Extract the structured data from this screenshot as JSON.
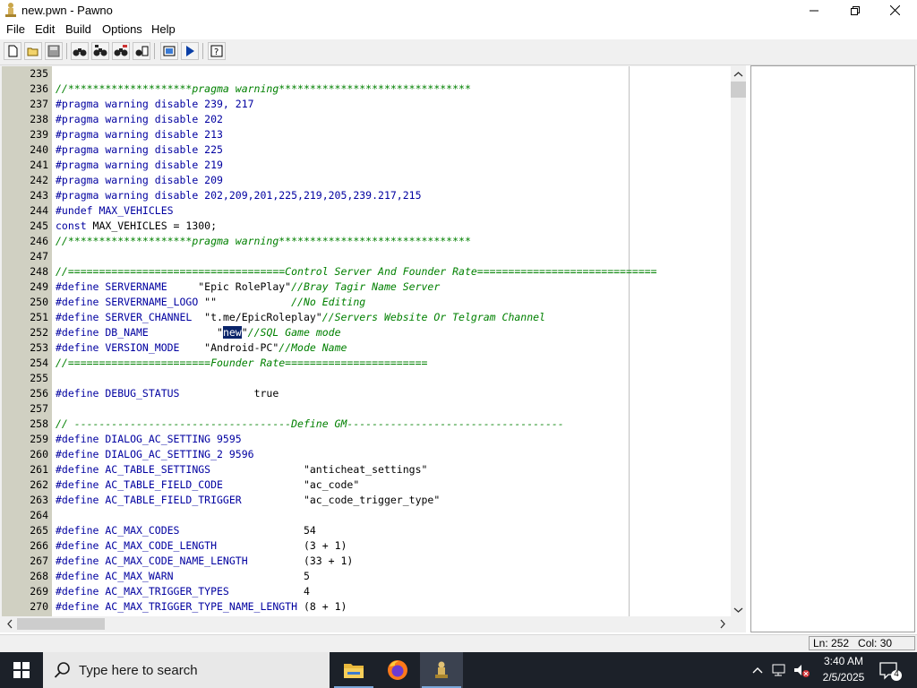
{
  "window": {
    "title": "new.pwn - Pawno"
  },
  "menu": [
    "File",
    "Edit",
    "Build",
    "Options",
    "Help"
  ],
  "toolbar": {
    "buttons": [
      "new-file-icon",
      "open-folder-icon",
      "save-icon",
      "find-icon",
      "find-next-icon",
      "replace-icon",
      "goto-line-icon",
      "compile-icon",
      "run-icon",
      "help-icon"
    ]
  },
  "editor": {
    "lines": [
      {
        "n": "235",
        "segs": []
      },
      {
        "n": "236",
        "segs": [
          {
            "t": "//********************pragma warning*******************************",
            "c": "cm"
          }
        ]
      },
      {
        "n": "237",
        "segs": [
          {
            "t": "#pragma warning disable 239, 217",
            "c": "kw"
          }
        ]
      },
      {
        "n": "238",
        "segs": [
          {
            "t": "#pragma warning disable 202",
            "c": "kw"
          }
        ]
      },
      {
        "n": "239",
        "segs": [
          {
            "t": "#pragma warning disable 213",
            "c": "kw"
          }
        ]
      },
      {
        "n": "240",
        "segs": [
          {
            "t": "#pragma warning disable 225",
            "c": "kw"
          }
        ]
      },
      {
        "n": "241",
        "segs": [
          {
            "t": "#pragma warning disable 219",
            "c": "kw"
          }
        ]
      },
      {
        "n": "242",
        "segs": [
          {
            "t": "#pragma warning disable 209",
            "c": "kw"
          }
        ]
      },
      {
        "n": "243",
        "segs": [
          {
            "t": "#pragma warning disable 202,209,201,225,219,205,239.217,215",
            "c": "kw"
          }
        ]
      },
      {
        "n": "244",
        "segs": [
          {
            "t": "#undef MAX_VEHICLES",
            "c": "kw"
          }
        ]
      },
      {
        "n": "245",
        "segs": [
          {
            "t": "const",
            "c": "kw"
          },
          {
            "t": " MAX_VEHICLES = 1300;",
            "c": "str"
          }
        ]
      },
      {
        "n": "246",
        "segs": [
          {
            "t": "//********************pragma warning*******************************",
            "c": "cm"
          }
        ]
      },
      {
        "n": "247",
        "segs": []
      },
      {
        "n": "248",
        "segs": [
          {
            "t": "//===================================Control Server And Founder Rate=============================",
            "c": "cm"
          }
        ]
      },
      {
        "n": "249",
        "segs": [
          {
            "t": "#define SERVERNAME",
            "c": "kw"
          },
          {
            "t": "     \"Epic RolePlay\"",
            "c": "str"
          },
          {
            "t": "//Bray Tagir Name Server",
            "c": "cm"
          }
        ]
      },
      {
        "n": "250",
        "segs": [
          {
            "t": "#define SERVERNAME_LOGO",
            "c": "kw"
          },
          {
            "t": " \"\"",
            "c": "str"
          },
          {
            "t": "            //No Editing",
            "c": "cm"
          }
        ]
      },
      {
        "n": "251",
        "segs": [
          {
            "t": "#define SERVER_CHANNEL",
            "c": "kw"
          },
          {
            "t": "  \"t.me/EpicRoleplay\"",
            "c": "str"
          },
          {
            "t": "//Servers Website Or Telgram Channel",
            "c": "cm"
          }
        ]
      },
      {
        "n": "252",
        "segs": [
          {
            "t": "#define DB_NAME",
            "c": "kw"
          },
          {
            "t": "           \"",
            "c": "str"
          },
          {
            "t": "new",
            "c": "sel"
          },
          {
            "t": "\"",
            "c": "str"
          },
          {
            "t": "//SQL Game mode",
            "c": "cm"
          }
        ]
      },
      {
        "n": "253",
        "segs": [
          {
            "t": "#define VERSION_MODE",
            "c": "kw"
          },
          {
            "t": "    \"Android-PC\"",
            "c": "str"
          },
          {
            "t": "//Mode Name",
            "c": "cm"
          }
        ]
      },
      {
        "n": "254",
        "segs": [
          {
            "t": "//=======================Founder Rate=======================",
            "c": "cm"
          }
        ]
      },
      {
        "n": "255",
        "segs": []
      },
      {
        "n": "256",
        "segs": [
          {
            "t": "#define DEBUG_STATUS",
            "c": "kw"
          },
          {
            "t": "            true",
            "c": "str"
          }
        ]
      },
      {
        "n": "257",
        "segs": []
      },
      {
        "n": "258",
        "segs": [
          {
            "t": "// -----------------------------------Define GM-----------------------------------",
            "c": "cm"
          }
        ]
      },
      {
        "n": "259",
        "segs": [
          {
            "t": "#define DIALOG_AC_SETTING 9595",
            "c": "kw"
          }
        ]
      },
      {
        "n": "260",
        "segs": [
          {
            "t": "#define DIALOG_AC_SETTING_2 9596",
            "c": "kw"
          }
        ]
      },
      {
        "n": "261",
        "segs": [
          {
            "t": "#define AC_TABLE_SETTINGS",
            "c": "kw"
          },
          {
            "t": "               \"anticheat_settings\"",
            "c": "str"
          }
        ]
      },
      {
        "n": "262",
        "segs": [
          {
            "t": "#define AC_TABLE_FIELD_CODE",
            "c": "kw"
          },
          {
            "t": "             \"ac_code\"",
            "c": "str"
          }
        ]
      },
      {
        "n": "263",
        "segs": [
          {
            "t": "#define AC_TABLE_FIELD_TRIGGER",
            "c": "kw"
          },
          {
            "t": "          \"ac_code_trigger_type\"",
            "c": "str"
          }
        ]
      },
      {
        "n": "264",
        "segs": []
      },
      {
        "n": "265",
        "segs": [
          {
            "t": "#define AC_MAX_CODES",
            "c": "kw"
          },
          {
            "t": "                    54",
            "c": "str"
          }
        ]
      },
      {
        "n": "266",
        "segs": [
          {
            "t": "#define AC_MAX_CODE_LENGTH",
            "c": "kw"
          },
          {
            "t": "              (3 + 1)",
            "c": "str"
          }
        ]
      },
      {
        "n": "267",
        "segs": [
          {
            "t": "#define AC_MAX_CODE_NAME_LENGTH",
            "c": "kw"
          },
          {
            "t": "         (33 + 1)",
            "c": "str"
          }
        ]
      },
      {
        "n": "268",
        "segs": [
          {
            "t": "#define AC_MAX_WARN",
            "c": "kw"
          },
          {
            "t": "                     5",
            "c": "str"
          }
        ]
      },
      {
        "n": "269",
        "segs": [
          {
            "t": "#define AC_MAX_TRIGGER_TYPES",
            "c": "kw"
          },
          {
            "t": "            4",
            "c": "str"
          }
        ]
      },
      {
        "n": "270",
        "segs": [
          {
            "t": "#define AC_MAX_TRIGGER_TYPE_NAME_LENGTH",
            "c": "kw"
          },
          {
            "t": " (8 + 1)",
            "c": "str"
          }
        ]
      }
    ]
  },
  "status": {
    "position": "Ln: 252   Col: 30"
  },
  "taskbar": {
    "search_placeholder": "Type here to search",
    "time": "3:40 AM",
    "date": "2/5/2025",
    "notification_count": "4"
  }
}
